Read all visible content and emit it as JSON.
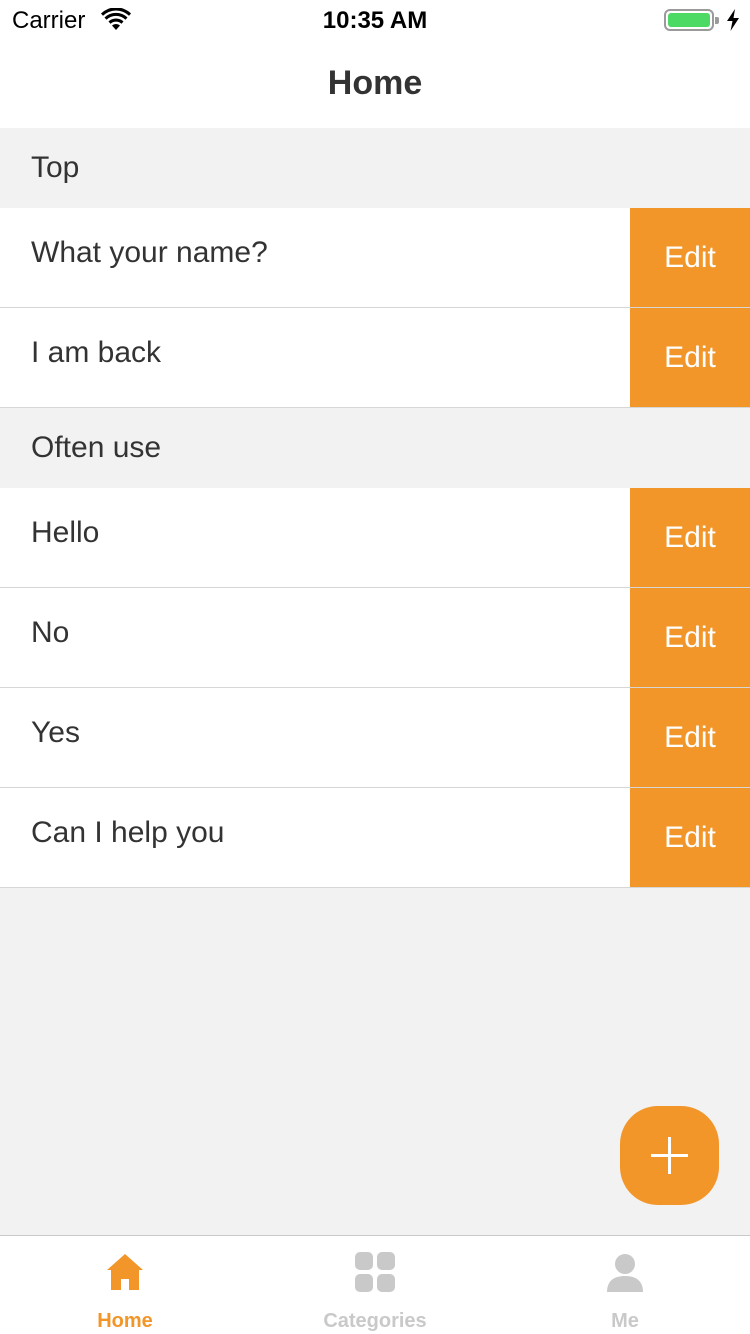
{
  "status": {
    "carrier": "Carrier",
    "time": "10:35 AM"
  },
  "nav": {
    "title": "Home"
  },
  "sections": [
    {
      "title": "Top",
      "items": [
        {
          "label": "What your name?",
          "action": "Edit"
        },
        {
          "label": "I am back",
          "action": "Edit"
        }
      ]
    },
    {
      "title": "Often use",
      "items": [
        {
          "label": "Hello",
          "action": "Edit"
        },
        {
          "label": "No",
          "action": "Edit"
        },
        {
          "label": "Yes",
          "action": "Edit"
        },
        {
          "label": "Can I help you",
          "action": "Edit"
        }
      ]
    }
  ],
  "fab": {
    "icon": "plus-icon"
  },
  "tabs": [
    {
      "label": "Home",
      "icon": "home-icon",
      "active": true
    },
    {
      "label": "Categories",
      "icon": "grid-icon",
      "active": false
    },
    {
      "label": "Me",
      "icon": "person-icon",
      "active": false
    }
  ],
  "colors": {
    "accent": "#f29629",
    "background": "#f2f2f2",
    "inactive": "#c9c9c9",
    "battery": "#4cd964"
  }
}
